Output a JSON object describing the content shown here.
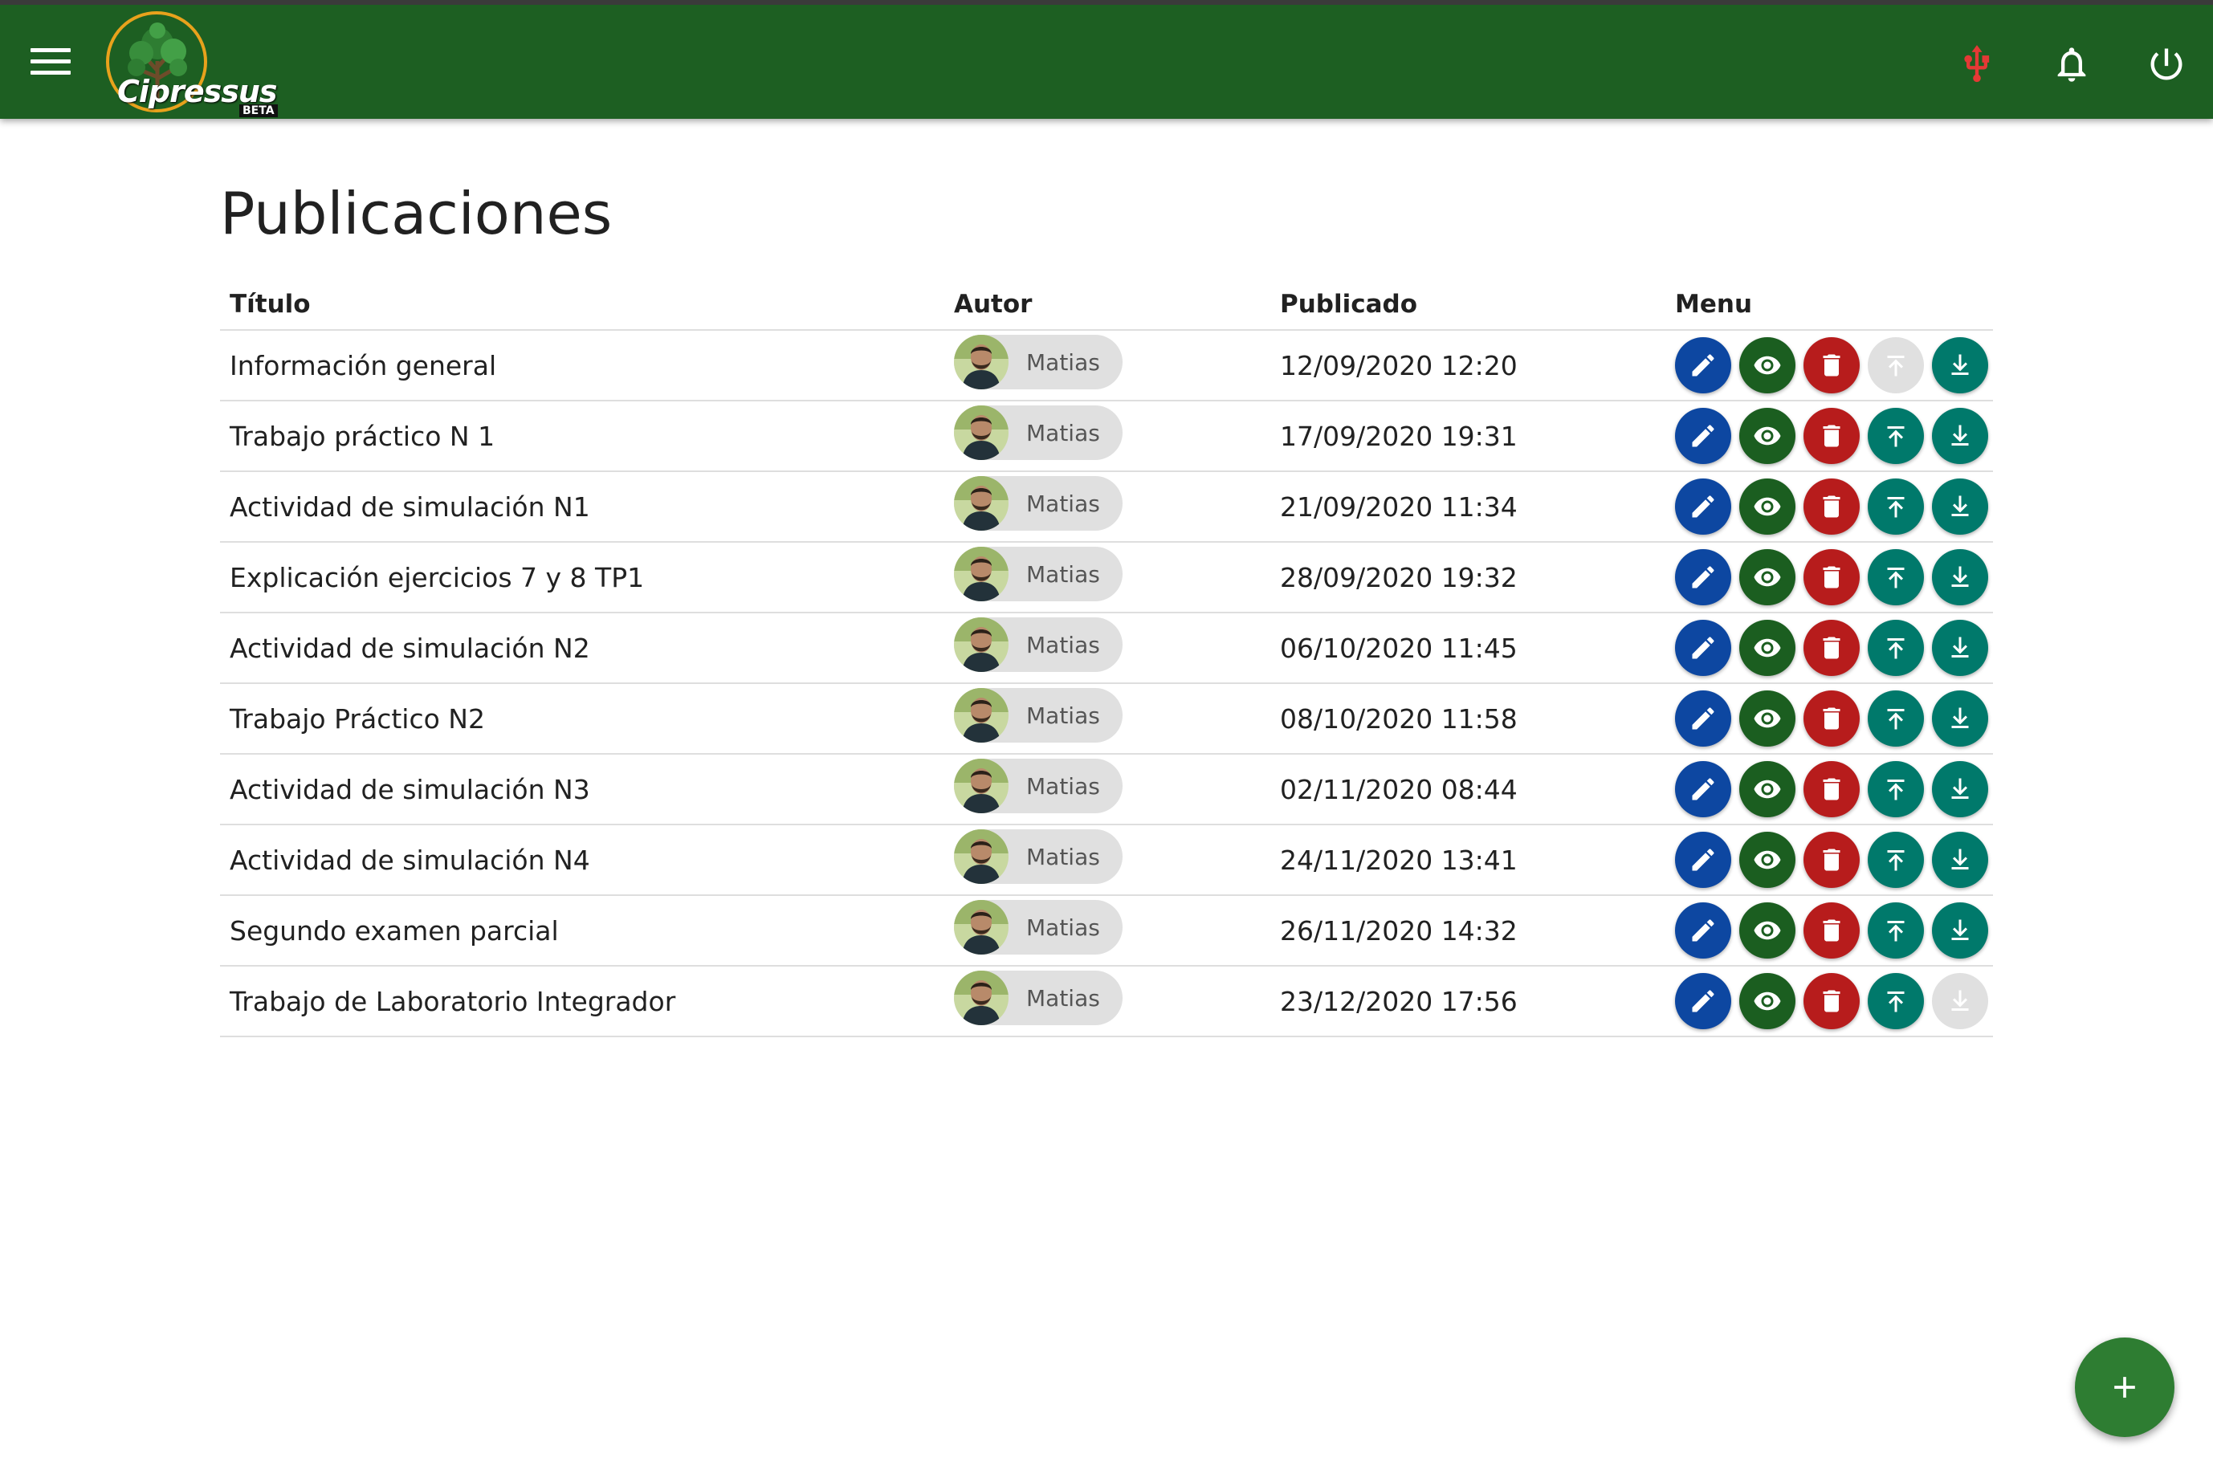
{
  "app": {
    "name": "Cipressus",
    "badge": "BETA"
  },
  "header_icons": [
    "menu-icon",
    "usb-icon",
    "bell-icon",
    "power-icon"
  ],
  "colors": {
    "topbar": "#1d5f22",
    "edit": "#0d47a1",
    "view": "#1b5e20",
    "delete": "#b71c1c",
    "upload": "#00796b",
    "download": "#00796b",
    "disabled": "#e0e0e0",
    "usb": "#e53935",
    "fab": "#2e7d32"
  },
  "page": {
    "title": "Publicaciones"
  },
  "table": {
    "headers": [
      "Título",
      "Autor",
      "Publicado",
      "Menu"
    ],
    "rows": [
      {
        "title": "Información general",
        "author": "Matias",
        "published": "12/09/2020 12:20",
        "upload_enabled": false,
        "download_enabled": true
      },
      {
        "title": "Trabajo práctico N 1",
        "author": "Matias",
        "published": "17/09/2020 19:31",
        "upload_enabled": true,
        "download_enabled": true
      },
      {
        "title": "Actividad de simulación N1",
        "author": "Matias",
        "published": "21/09/2020 11:34",
        "upload_enabled": true,
        "download_enabled": true
      },
      {
        "title": "Explicación ejercicios 7 y 8 TP1",
        "author": "Matias",
        "published": "28/09/2020 19:32",
        "upload_enabled": true,
        "download_enabled": true
      },
      {
        "title": "Actividad de simulación N2",
        "author": "Matias",
        "published": "06/10/2020 11:45",
        "upload_enabled": true,
        "download_enabled": true
      },
      {
        "title": "Trabajo Práctico N2",
        "author": "Matias",
        "published": "08/10/2020 11:58",
        "upload_enabled": true,
        "download_enabled": true
      },
      {
        "title": "Actividad de simulación N3",
        "author": "Matias",
        "published": "02/11/2020 08:44",
        "upload_enabled": true,
        "download_enabled": true
      },
      {
        "title": "Actividad de simulación N4",
        "author": "Matias",
        "published": "24/11/2020 13:41",
        "upload_enabled": true,
        "download_enabled": true
      },
      {
        "title": "Segundo examen parcial",
        "author": "Matias",
        "published": "26/11/2020 14:32",
        "upload_enabled": true,
        "download_enabled": true
      },
      {
        "title": "Trabajo de Laboratorio Integrador",
        "author": "Matias",
        "published": "23/12/2020 17:56",
        "upload_enabled": true,
        "download_enabled": false
      }
    ],
    "row_actions": [
      "edit-icon",
      "eye-icon",
      "trash-icon",
      "upload-icon",
      "download-icon"
    ]
  },
  "fab_icon": "plus-icon"
}
